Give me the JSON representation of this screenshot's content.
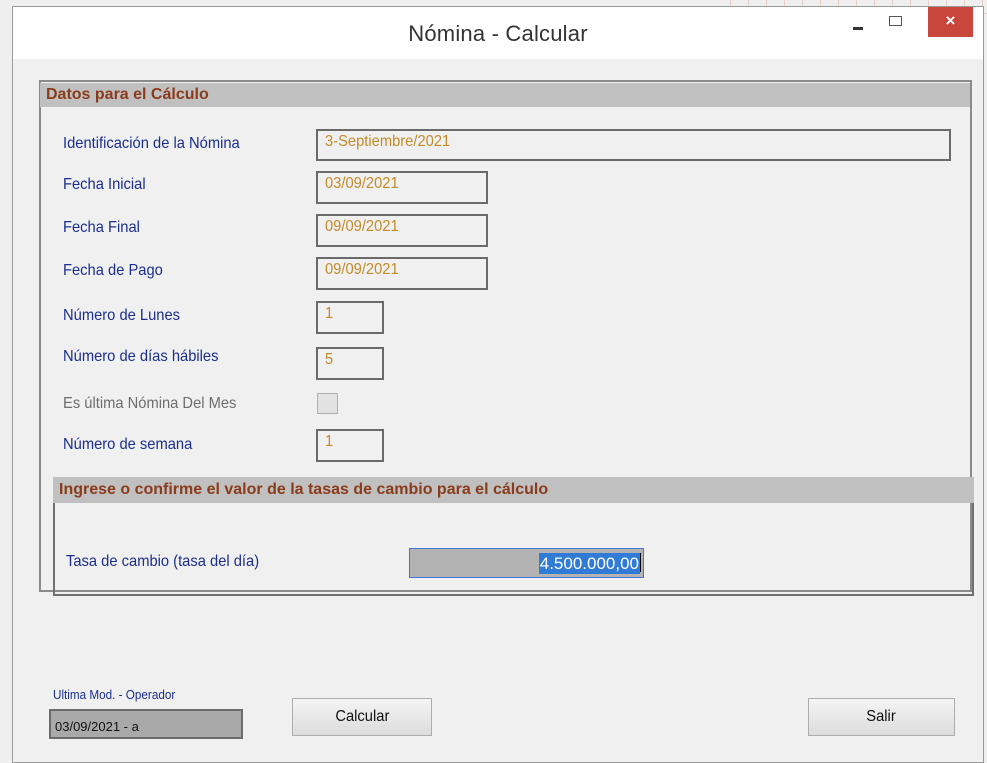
{
  "window": {
    "title": "Nómina - Calcular",
    "close_glyph": "×"
  },
  "section1": {
    "header": "Datos para el Cálculo",
    "fields": {
      "identificacion": {
        "label": "Identificación de la Nómina",
        "value": "3-Septiembre/2021"
      },
      "fecha_inicial": {
        "label": "Fecha Inicial",
        "value": "03/09/2021"
      },
      "fecha_final": {
        "label": "Fecha Final",
        "value": "09/09/2021"
      },
      "fecha_pago": {
        "label": "Fecha de Pago",
        "value": "09/09/2021"
      },
      "numero_lunes": {
        "label": "Número de Lunes",
        "value": "1"
      },
      "dias_habiles": {
        "label": "Número de días hábiles",
        "value": "5"
      },
      "ultima_nomina": {
        "label": "Es última Nómina Del Mes",
        "checked": false
      },
      "numero_semana": {
        "label": "Número de semana",
        "value": "1"
      }
    }
  },
  "section2": {
    "header": "Ingrese o confirme el valor de la tasas de cambio para el cálculo",
    "tasa": {
      "label": "Tasa de cambio (tasa del día)",
      "value": "4.500.000,00"
    }
  },
  "footer": {
    "operator_label": "Ultima Mod. - Operador",
    "operator_value": "03/09/2021 - a",
    "calcular_label": "Calcular",
    "salir_label": "Salir"
  }
}
